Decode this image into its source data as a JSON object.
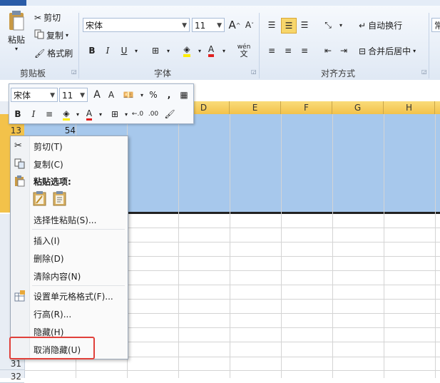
{
  "ribbon": {
    "clipboard": {
      "paste": "粘贴",
      "cut": "剪切",
      "copy": "复制",
      "format_painter": "格式刷",
      "group": "剪贴板"
    },
    "font": {
      "name": "宋体",
      "size": "11",
      "group": "字体",
      "phonetic": "wén"
    },
    "alignment": {
      "wrap": "自动换行",
      "merge": "合并后居中",
      "group": "对齐方式"
    },
    "number": {
      "label": "常"
    }
  },
  "grid": {
    "columns": [
      "D",
      "E",
      "F",
      "G",
      "H"
    ],
    "rows": [
      {
        "num": "13",
        "cell": "54"
      },
      {
        "num": "31",
        "cell": ""
      },
      {
        "num": "32",
        "cell": ""
      }
    ]
  },
  "mini_toolbar": {
    "font": "宋体",
    "size": "11",
    "percent": "%",
    "comma": ","
  },
  "context_menu": {
    "items": [
      {
        "label": "剪切(T)",
        "icon": "scissors-icon"
      },
      {
        "label": "复制(C)",
        "icon": "copy-icon"
      },
      {
        "label": "粘贴选项:",
        "icon": "paste-icon"
      },
      {
        "label": "选择性粘贴(S)...",
        "icon": ""
      },
      {
        "label": "插入(I)",
        "icon": ""
      },
      {
        "label": "删除(D)",
        "icon": ""
      },
      {
        "label": "清除内容(N)",
        "icon": ""
      },
      {
        "label": "设置单元格格式(F)...",
        "icon": "format-cells-icon"
      },
      {
        "label": "行高(R)...",
        "icon": ""
      },
      {
        "label": "隐藏(H)",
        "icon": ""
      },
      {
        "label": "取消隐藏(U)",
        "icon": ""
      }
    ]
  },
  "colors": {
    "selection": "#a7c8ec",
    "column_header_selected": "#f5c94f",
    "highlight_box": "#e0403a",
    "ribbon_bg": "#dfe8f4"
  }
}
